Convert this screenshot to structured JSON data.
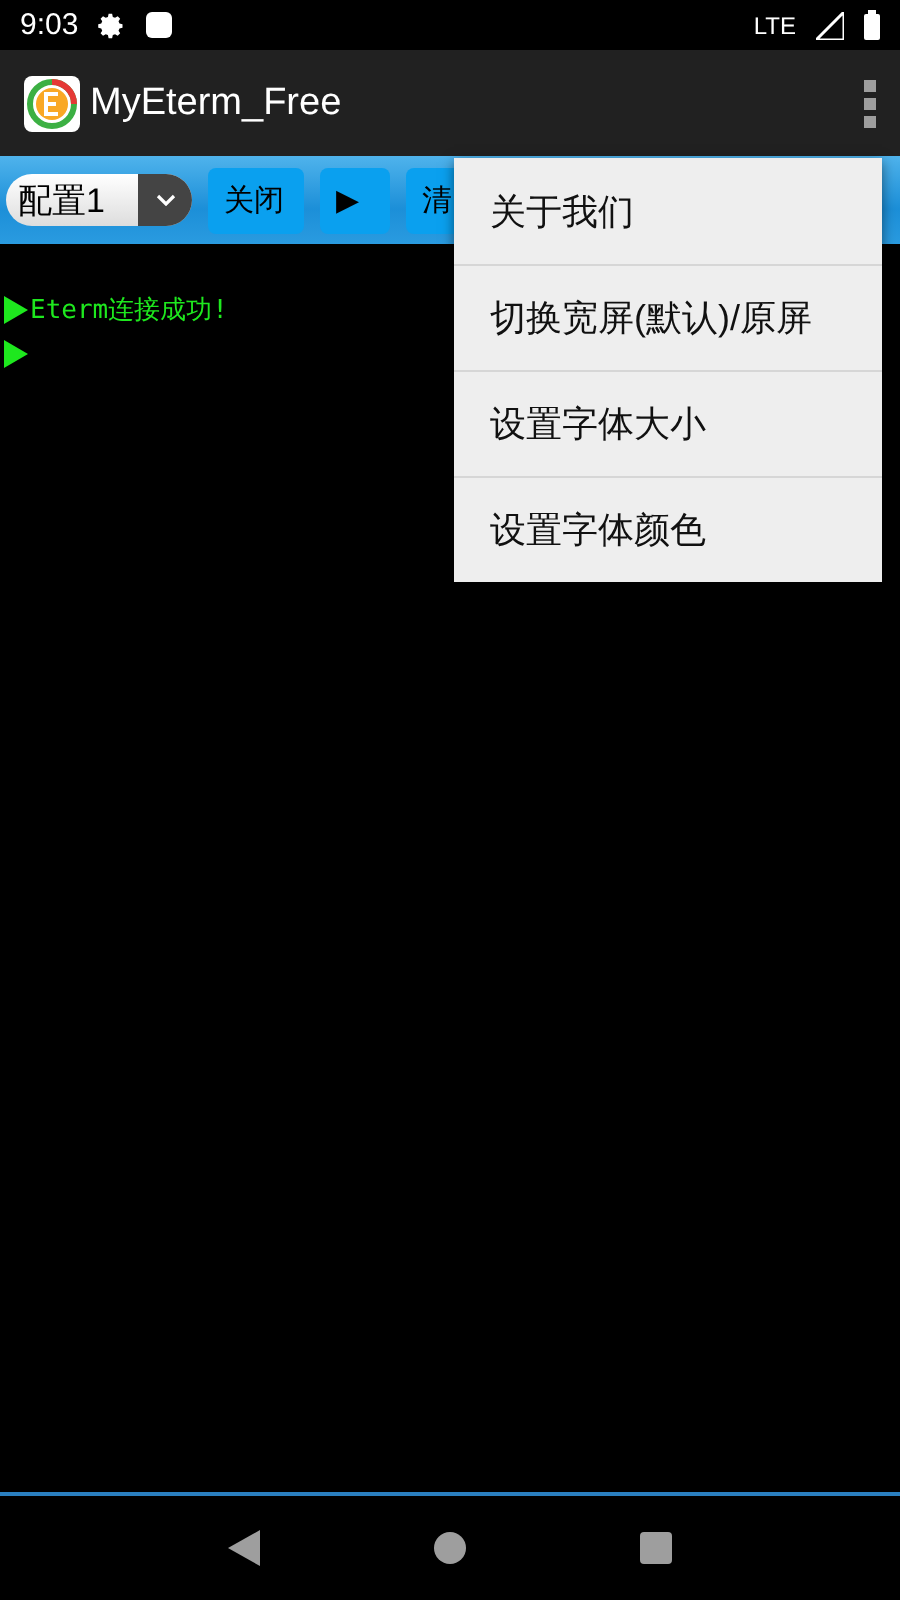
{
  "status_bar": {
    "time": "9:03",
    "network": "LTE"
  },
  "app_bar": {
    "title": "MyEterm_Free"
  },
  "toolbar": {
    "config_select": {
      "value": "配置1"
    },
    "buttons": [
      {
        "label": "关闭",
        "kind": "text"
      },
      {
        "label": "▶",
        "kind": "text"
      },
      {
        "label": "清",
        "kind": "text"
      }
    ]
  },
  "terminal": {
    "lines": [
      {
        "text": "Eterm连接成功!"
      }
    ]
  },
  "menu": {
    "items": [
      {
        "label": "关于我们"
      },
      {
        "label": "切换宽屏(默认)/原屏"
      },
      {
        "label": "设置字体大小"
      },
      {
        "label": "设置字体颜色"
      }
    ]
  }
}
